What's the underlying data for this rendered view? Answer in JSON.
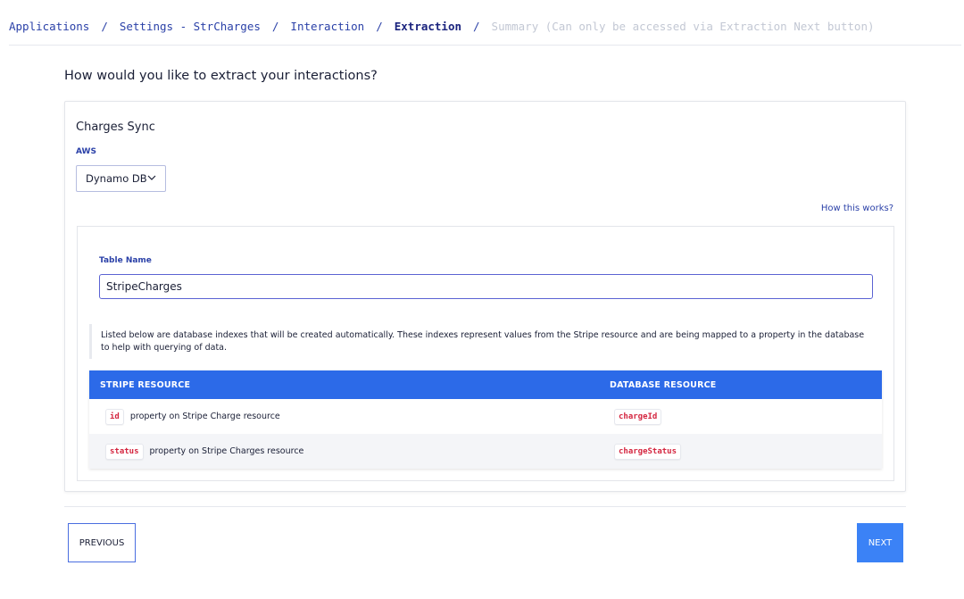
{
  "breadcrumb": {
    "items": [
      {
        "label": "Applications"
      },
      {
        "label": "Settings - StrCharges"
      },
      {
        "label": "Interaction"
      },
      {
        "label": "Extraction"
      },
      {
        "label": "Summary (Can only be accessed via Extraction Next button)"
      }
    ],
    "separator": "/"
  },
  "page": {
    "question": "How would you like to extract your interactions?"
  },
  "card": {
    "title": "Charges Sync",
    "provider_label": "AWS",
    "provider_select_value": "Dynamo DB",
    "how_link": "How this works?",
    "table_name_label": "Table Name",
    "table_name_value": "StripeCharges",
    "info_text": "Listed below are database indexes that will be created automatically. These indexes represent values from the Stripe resource and are being mapped to a property in the database to help with querying of data."
  },
  "table": {
    "headers": [
      "STRIPE RESOURCE",
      "DATABASE RESOURCE"
    ],
    "rows": [
      {
        "code": "id",
        "desc": "property on Stripe Charge resource",
        "db": "chargeId"
      },
      {
        "code": "status",
        "desc": "property on Stripe Charges resource",
        "db": "chargeStatus"
      }
    ]
  },
  "footer": {
    "previous_label": "PREVIOUS",
    "next_label": "NEXT"
  },
  "colors": {
    "accent": "#2b41a8",
    "table_header": "#2c6ae8",
    "next_button": "#3b82f6",
    "code_text": "#d4253f"
  }
}
